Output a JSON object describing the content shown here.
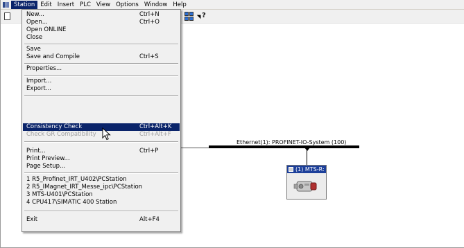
{
  "menubar": {
    "items": [
      "Station",
      "Edit",
      "Insert",
      "PLC",
      "View",
      "Options",
      "Window",
      "Help"
    ],
    "active": "Station"
  },
  "toolbar": {
    "icons": [
      "new-icon",
      "network-view-icon",
      "help-pointer-icon"
    ],
    "help_glyph": "?"
  },
  "menu": {
    "items": [
      {
        "label": "New...",
        "shortcut": "Ctrl+N"
      },
      {
        "label": "Open...",
        "shortcut": "Ctrl+O"
      },
      {
        "label": "Open ONLINE",
        "shortcut": ""
      },
      {
        "label": "Close",
        "shortcut": ""
      },
      {
        "label": "Save",
        "shortcut": ""
      },
      {
        "label": "Save and Compile",
        "shortcut": "Ctrl+S"
      },
      {
        "label": "Properties...",
        "shortcut": ""
      },
      {
        "label": "Import...",
        "shortcut": ""
      },
      {
        "label": "Export...",
        "shortcut": ""
      },
      {
        "label": "Consistency Check",
        "shortcut": "Ctrl+Alt+K",
        "state": "highlighted"
      },
      {
        "label": "Check GR Compatibility",
        "shortcut": "Ctrl+Alt+F",
        "state": "disabled"
      },
      {
        "label": "Print...",
        "shortcut": "Ctrl+P"
      },
      {
        "label": "Print Preview...",
        "shortcut": ""
      },
      {
        "label": "Page Setup...",
        "shortcut": ""
      },
      {
        "label": "1 R5_Profinet_IRT_U402\\PCStation",
        "shortcut": ""
      },
      {
        "label": "2 R5_IMagnet_IRT_Messe_ipc\\PCStation",
        "shortcut": ""
      },
      {
        "label": "3 MTS-U401\\PCStation",
        "shortcut": ""
      },
      {
        "label": "4 CPU417\\SIMATIC 400 Station",
        "shortcut": ""
      },
      {
        "label": "Exit",
        "shortcut": "Alt+F4"
      }
    ]
  },
  "network": {
    "bus_label": "Ethernet(1): PROFINET-IO-System (100)",
    "device_label": "(1) MTS-R:"
  },
  "colors": {
    "highlight": "#0a246a",
    "device_header": "#1c3f9a",
    "menubar_bg": "#f0f0f0"
  }
}
